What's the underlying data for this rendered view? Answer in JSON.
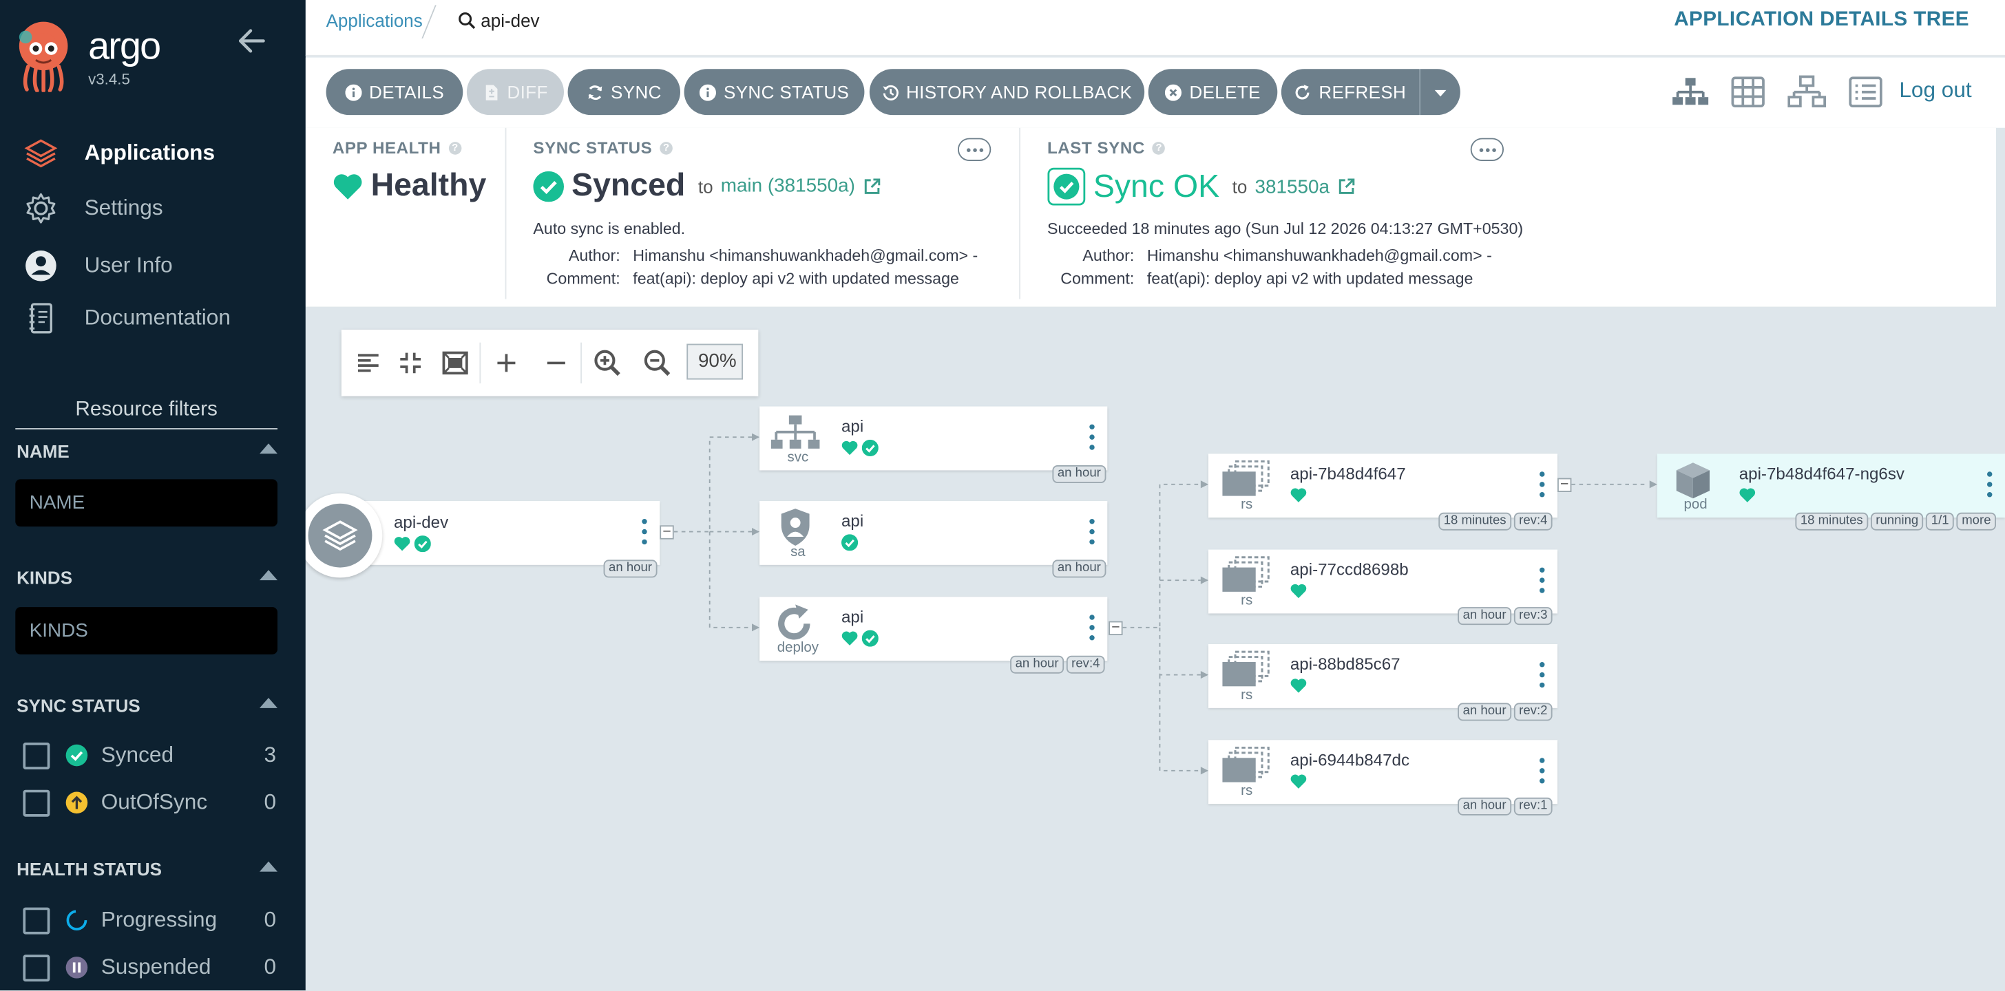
{
  "brand": {
    "name": "argo",
    "version": "v3.4.5"
  },
  "nav": [
    {
      "label": "Applications",
      "icon": "layers-icon"
    },
    {
      "label": "Settings",
      "icon": "gear-icon"
    },
    {
      "label": "User Info",
      "icon": "user-circle-icon"
    },
    {
      "label": "Documentation",
      "icon": "book-icon"
    }
  ],
  "filters": {
    "title": "Resource filters",
    "name_label": "NAME",
    "name_placeholder": "NAME",
    "kinds_label": "KINDS",
    "kinds_placeholder": "KINDS",
    "sync_label": "SYNC STATUS",
    "sync_items": [
      {
        "label": "Synced",
        "count": "3"
      },
      {
        "label": "OutOfSync",
        "count": "0"
      }
    ],
    "health_label": "HEALTH STATUS",
    "health_items": [
      {
        "label": "Progressing",
        "count": "0"
      },
      {
        "label": "Suspended",
        "count": "0"
      }
    ]
  },
  "breadcrumb": {
    "root": "Applications",
    "current": "api-dev"
  },
  "page_title": "APPLICATION DETAILS TREE",
  "toolbar": {
    "details": "DETAILS",
    "diff": "DIFF",
    "sync": "SYNC",
    "sync_status": "SYNC STATUS",
    "history": "HISTORY AND ROLLBACK",
    "delete": "DELETE",
    "refresh": "REFRESH",
    "logout": "Log out"
  },
  "app_health": {
    "label": "APP HEALTH",
    "value": "Healthy"
  },
  "sync_status": {
    "label": "SYNC STATUS",
    "value": "Synced",
    "to": "to",
    "revision": "main (381550a)",
    "auto_sync": "Auto sync is enabled.",
    "author_key": "Author:",
    "author": "Himanshu <himanshuwankhadeh@gmail.com> -",
    "comment_key": "Comment:",
    "comment": "feat(api): deploy api v2 with updated message"
  },
  "last_sync": {
    "label": "LAST SYNC",
    "value": "Sync OK",
    "to": "to",
    "revision": "381550a",
    "succeeded": "Succeeded 18 minutes ago (Sun Jul 12 2026 04:13:27 GMT+0530)",
    "author_key": "Author:",
    "author": "Himanshu <himanshuwankhadeh@gmail.com> -",
    "comment_key": "Comment:",
    "comment": "feat(api): deploy api v2 with updated message"
  },
  "zoom": {
    "value": "90%"
  },
  "graph": {
    "app": {
      "name": "api-dev",
      "tags": [
        "an hour"
      ]
    },
    "svc": {
      "name": "api",
      "kind": "svc",
      "tags": [
        "an hour"
      ]
    },
    "sa": {
      "name": "api",
      "kind": "sa",
      "tags": [
        "an hour"
      ]
    },
    "deploy": {
      "name": "api",
      "kind": "deploy",
      "tags": [
        "an hour",
        "rev:4"
      ]
    },
    "rs": [
      {
        "name": "api-7b48d4f647",
        "kind": "rs",
        "tags": [
          "18 minutes",
          "rev:4"
        ]
      },
      {
        "name": "api-77ccd8698b",
        "kind": "rs",
        "tags": [
          "an hour",
          "rev:3"
        ]
      },
      {
        "name": "api-88bd85c67",
        "kind": "rs",
        "tags": [
          "an hour",
          "rev:2"
        ]
      },
      {
        "name": "api-6944b847dc",
        "kind": "rs",
        "tags": [
          "an hour",
          "rev:1"
        ]
      }
    ],
    "pod": {
      "name": "api-7b48d4f647-ng6sv",
      "kind": "pod",
      "tags": [
        "18 minutes",
        "running",
        "1/1",
        "more"
      ]
    }
  },
  "colors": {
    "sidebar": "#0d2130",
    "accent": "#2c7a99",
    "healthy": "#18be94",
    "canvas": "#dee6eb",
    "button": "#6d7f8b"
  }
}
